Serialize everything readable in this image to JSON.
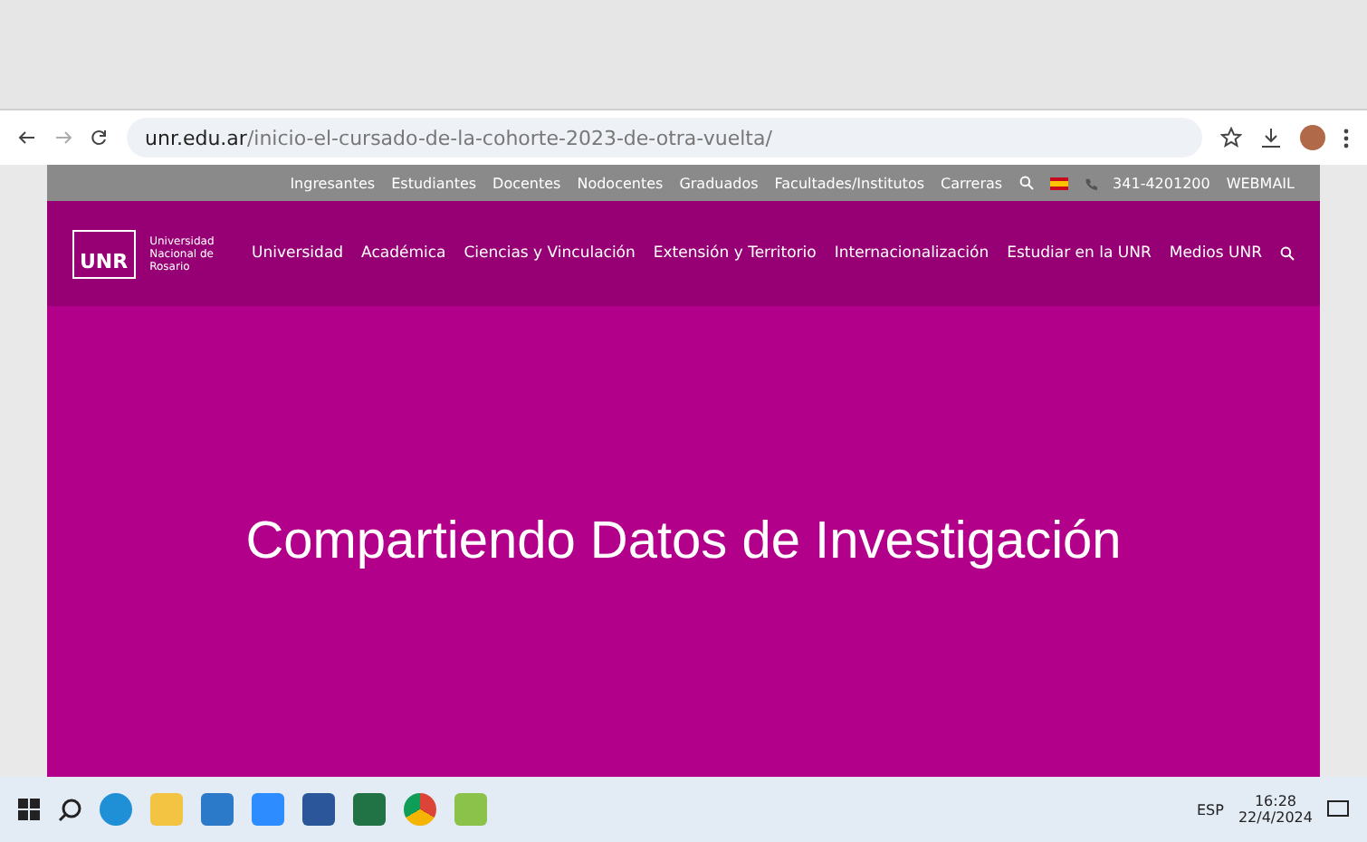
{
  "browser": {
    "url_domain": "unr.edu.ar",
    "url_path": "/inicio-el-cursado-de-la-cohorte-2023-de-otra-vuelta/"
  },
  "top_nav": {
    "links": [
      "Ingresantes",
      "Estudiantes",
      "Docentes",
      "Nodocentes",
      "Graduados",
      "Facultades/Institutos",
      "Carreras"
    ],
    "phone": "341-4201200",
    "webmail": "WEBMAIL"
  },
  "header": {
    "logo": "UNR",
    "logo_caption": "Universidad Nacional de Rosario",
    "menu": [
      "Universidad",
      "Académica",
      "Ciencias y Vinculación",
      "Extensión y Territorio",
      "Internacionalización",
      "Estudiar en la UNR",
      "Medios UNR"
    ]
  },
  "hero": {
    "title": "Compartiendo Datos de Investigación"
  },
  "taskbar": {
    "language": "ESP",
    "time": "16:28",
    "date": "22/4/2024"
  }
}
